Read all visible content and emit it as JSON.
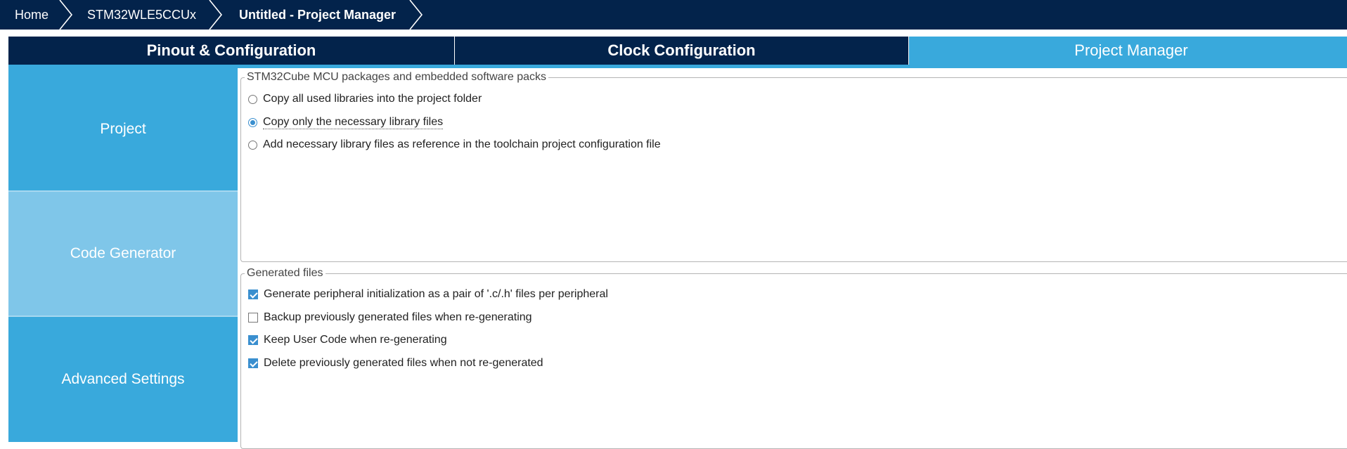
{
  "breadcrumb": [
    {
      "label": "Home"
    },
    {
      "label": "STM32WLE5CCUx"
    },
    {
      "label": "Untitled - Project Manager"
    }
  ],
  "tabs": [
    {
      "label": "Pinout & Configuration"
    },
    {
      "label": "Clock Configuration"
    },
    {
      "label": "Project Manager"
    }
  ],
  "sidebar": {
    "items": [
      {
        "label": "Project"
      },
      {
        "label": "Code Generator"
      },
      {
        "label": "Advanced Settings"
      }
    ]
  },
  "packages_group": {
    "title": "STM32Cube MCU packages and embedded software packs",
    "options": [
      {
        "label": "Copy all used libraries into the project folder",
        "selected": false
      },
      {
        "label": "Copy only the necessary library files",
        "selected": true
      },
      {
        "label": "Add necessary library files as reference in the toolchain project configuration file",
        "selected": false
      }
    ]
  },
  "generated_group": {
    "title": "Generated files",
    "options": [
      {
        "label": "Generate peripheral initialization as a pair of '.c/.h' files per peripheral",
        "checked": true
      },
      {
        "label": "Backup previously generated files when re-generating",
        "checked": false
      },
      {
        "label": "Keep User Code when re-generating",
        "checked": true
      },
      {
        "label": "Delete previously generated files when not re-generated",
        "checked": true
      }
    ]
  },
  "colors": {
    "navy": "#03234b",
    "accent": "#39a9dc",
    "selected_nav": "#7fc6e9"
  }
}
